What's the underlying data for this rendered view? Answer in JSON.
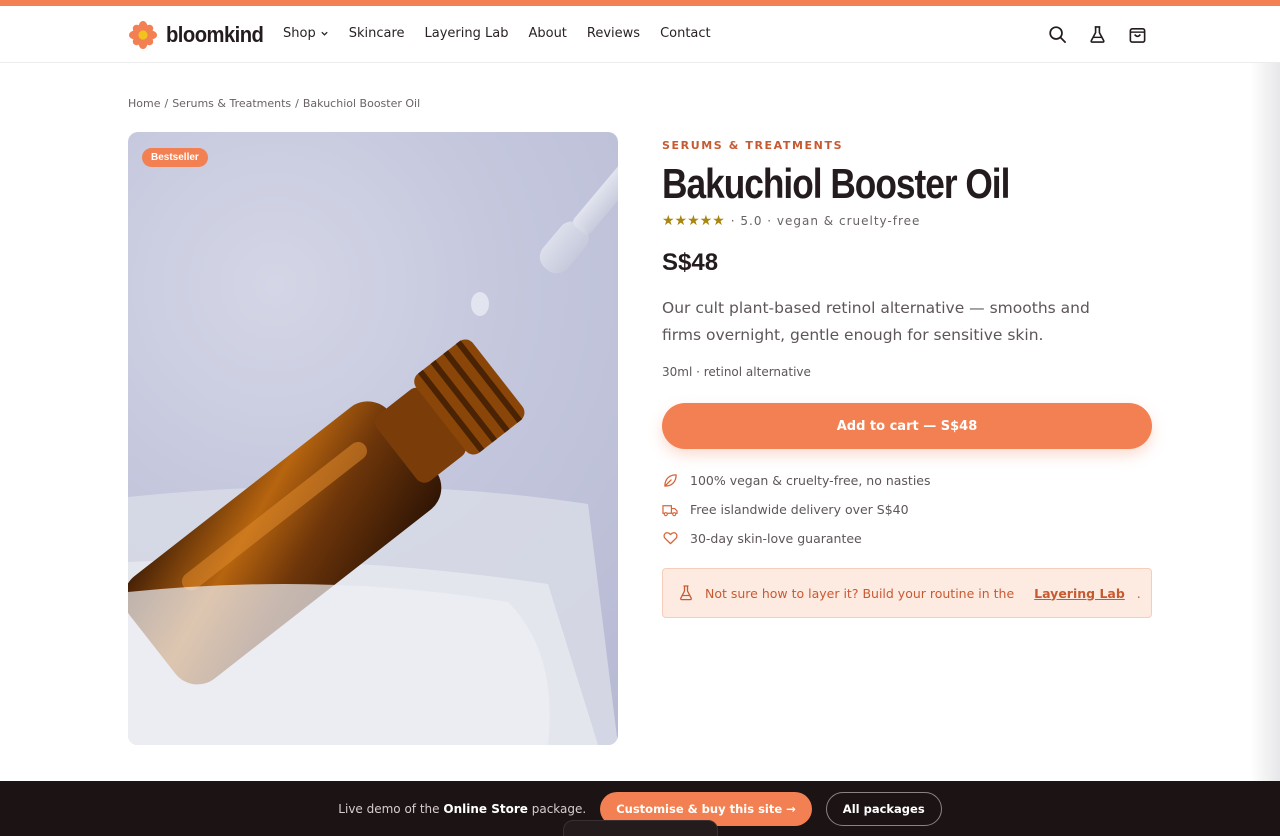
{
  "colors": {
    "accent": "#f38052",
    "accent_dark": "#c85a32",
    "star": "#a8860f",
    "text_dark": "#231b1d",
    "tint_bg": "#fdebe2",
    "footer_bg": "#1c1315"
  },
  "header": {
    "brand": "bloomkind",
    "nav": [
      {
        "label": "Shop",
        "has_dropdown": true
      },
      {
        "label": "Skincare"
      },
      {
        "label": "Layering Lab"
      },
      {
        "label": "About"
      },
      {
        "label": "Reviews"
      },
      {
        "label": "Contact"
      }
    ],
    "icons": [
      "search-icon",
      "flask-icon",
      "cart-icon"
    ]
  },
  "breadcrumb": [
    "Home",
    "/",
    "Serums & Treatments",
    "/",
    "Bakuchiol Booster Oil"
  ],
  "product": {
    "badge": "Bestseller",
    "category": "SERUMS & TREATMENTS",
    "title": "Bakuchiol Booster Oil",
    "stars": "★★★★★",
    "rating_text": "· 5.0 · vegan & cruelty-free",
    "price": "S$48",
    "description": "Our cult plant-based retinol alternative — smooths and firms overnight, gentle enough for sensitive skin.",
    "meta": "30ml · retinol alternative",
    "cart_button": "Add to cart — S$48",
    "perks": [
      {
        "icon": "leaf-icon",
        "text": "100% vegan & cruelty-free, no nasties"
      },
      {
        "icon": "truck-icon",
        "text": "Free islandwide delivery over S$40"
      },
      {
        "icon": "heart-icon",
        "text": "30-day skin-love guarantee"
      }
    ],
    "layering_prompt": {
      "text": "Not sure how to layer it? Build your routine in the",
      "link": "Layering Lab",
      "suffix": "."
    }
  },
  "demo_bar": {
    "prefix": "Live demo of the",
    "bold": "Online Store",
    "suffix": "package.",
    "cta": "Customise & buy this site →",
    "secondary": "All packages"
  }
}
